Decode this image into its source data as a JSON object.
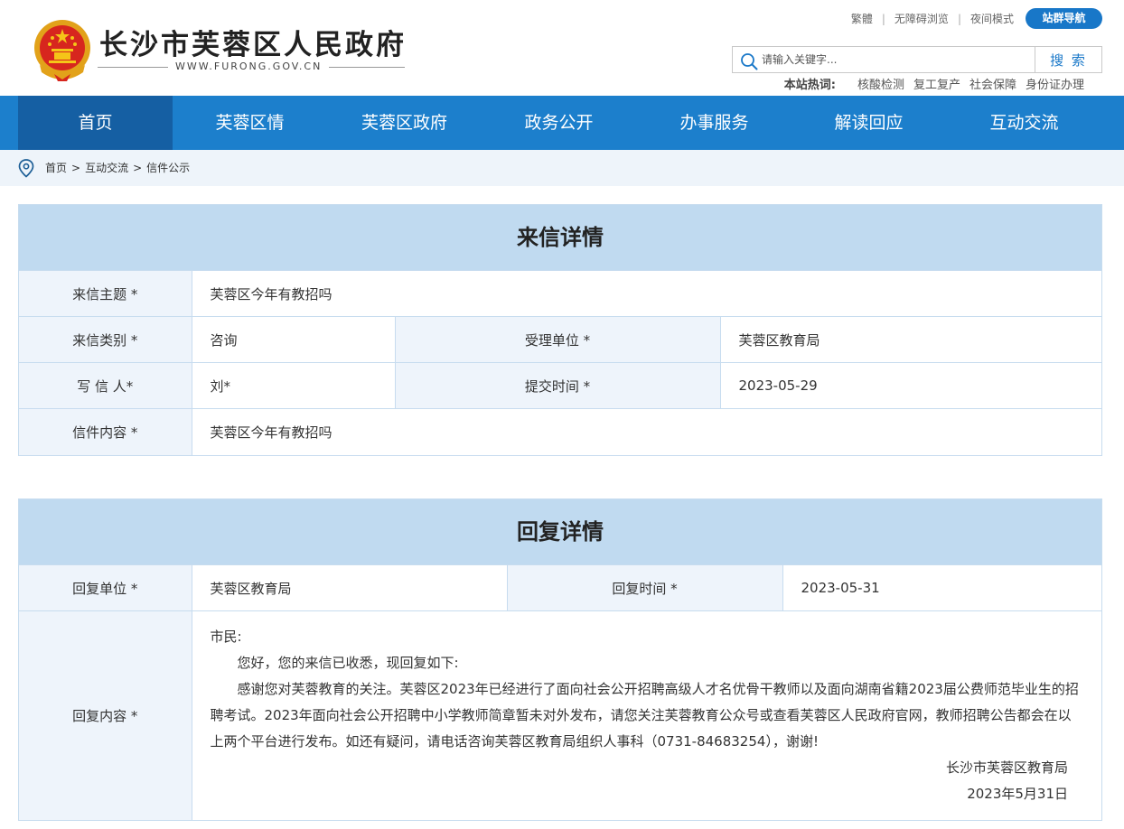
{
  "header": {
    "site_title": "长沙市芙蓉区人民政府",
    "site_url": "WWW.FURONG.GOV.CN",
    "top_links": [
      "繁體",
      "无障碍浏览",
      "夜间模式"
    ],
    "nav_site_button": "站群导航",
    "search": {
      "placeholder": "请输入关键字...",
      "button": "搜 索"
    },
    "hotwords": {
      "label": "本站热词:",
      "items": [
        "核酸检测",
        "复工复产",
        "社会保障",
        "身份证办理"
      ]
    }
  },
  "nav": {
    "items": [
      "首页",
      "芙蓉区情",
      "芙蓉区政府",
      "政务公开",
      "办事服务",
      "解读回应",
      "互动交流"
    ],
    "active_index": 0
  },
  "breadcrumb": [
    "首页",
    "互动交流",
    "信件公示"
  ],
  "letter": {
    "title": "来信详情",
    "subject_label": "来信主题 *",
    "subject": "芙蓉区今年有教招吗",
    "category_label": "来信类别 *",
    "category": "咨询",
    "unit_label": "受理单位 *",
    "unit": "芙蓉区教育局",
    "writer_label": "写 信 人*",
    "writer": "刘*",
    "submit_time_label": "提交时间 *",
    "submit_time": "2023-05-29",
    "content_label": "信件内容 *",
    "content": "芙蓉区今年有教招吗"
  },
  "reply": {
    "title": "回复详情",
    "unit_label": "回复单位 *",
    "unit": "芙蓉区教育局",
    "time_label": "回复时间 *",
    "time": "2023-05-31",
    "content_label": "回复内容 *",
    "salutation": "市民:",
    "para1": "您好，您的来信已收悉，现回复如下:",
    "para2": "感谢您对芙蓉教育的关注。芙蓉区2023年已经进行了面向社会公开招聘高级人才名优骨干教师以及面向湖南省籍2023届公费师范毕业生的招聘考试。2023年面向社会公开招聘中小学教师简章暂未对外发布，请您关注芙蓉教育公众号或查看芙蓉区人民政府官网，教师招聘公告都会在以上两个平台进行发布。如还有疑问，请电话咨询芙蓉区教育局组织人事科（0731-84683254），谢谢!",
    "signature": "长沙市芙蓉区教育局",
    "date": "2023年5月31日"
  },
  "colors": {
    "nav_bg": "#1c7fcc",
    "nav_active": "#155fa3",
    "panel_head": "#c0daf0",
    "label_bg": "#eef4fb",
    "accent": "#1877c8"
  },
  "icons": {
    "emblem": "national-emblem-icon",
    "search": "search-icon",
    "location": "location-pin-icon"
  }
}
